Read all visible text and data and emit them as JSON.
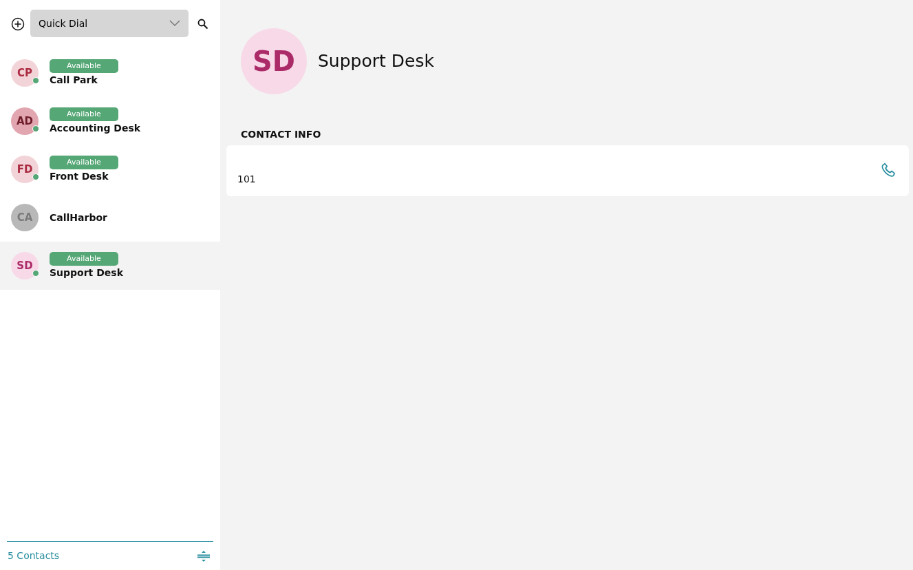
{
  "toolbar": {
    "dropdown": "Quick Dial"
  },
  "contacts": [
    {
      "initials": "CP",
      "name": "Call Park",
      "status": "Available",
      "online": true,
      "color": "#f2d3d8",
      "selected": false
    },
    {
      "initials": "AD",
      "name": "Accounting Desk",
      "status": "Available",
      "online": true,
      "color": "#e2a6b0",
      "selected": false
    },
    {
      "initials": "FD",
      "name": "Front Desk",
      "status": "Available",
      "online": true,
      "color": "#f2d3d8",
      "selected": false
    },
    {
      "initials": "CA",
      "name": "CallHarbor",
      "online": false,
      "color": "#b8b8b8",
      "selected": false
    },
    {
      "initials": "SD",
      "name": "Support Desk",
      "status": "Available",
      "online": true,
      "color": "#f8d9e8",
      "selected": true
    }
  ],
  "footer": {
    "count": "5 Contacts"
  },
  "detail": {
    "initials": "SD",
    "name": "Support Desk",
    "color": "#f8d9e8",
    "section": "CONTACT INFO",
    "number": "101"
  }
}
